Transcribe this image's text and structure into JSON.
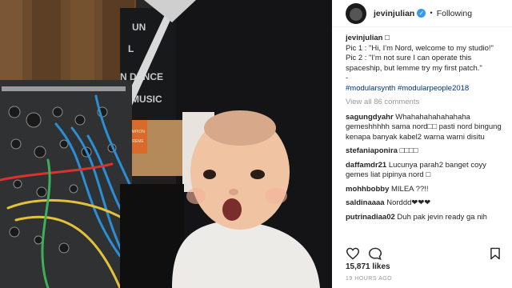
{
  "post": {
    "username": "jevinjulian",
    "follow_label": "Following",
    "separator": "•",
    "verified_icon": "verified-badge-icon"
  },
  "poster": {
    "wall_sign_lines": [
      "UN",
      "L",
      "N DENCE",
      "D MUSIC"
    ],
    "sticker_lines": [
      "CHAMPION",
      "SUPREME"
    ]
  },
  "caption": {
    "username": "jevinjulian",
    "lines": [
      "Pic 1 : \"Hi, I'm Nord, welcome to my studio!\"",
      "Pic 2 : \"I'm not sure I can operate this spaceship, but lemme try my first patch.\"",
      "-"
    ],
    "hashtags": "#modularsynth #modularpeople2018",
    "emoji": "□"
  },
  "view_all": "View all 86 comments",
  "comments": [
    {
      "user": "sagungdyahr",
      "text": "Whahahahahahahaha gemeshhhhh sama nord□□ pasti nord bingung kenapa banyak kabel2 warna warni disitu"
    },
    {
      "user": "stefaniaponira",
      "text": "□□□□"
    },
    {
      "user": "daffamdr21",
      "text": "Lucunya parah2 banget coyy gemes liat pipinya nord □"
    },
    {
      "user": "mohhbobby",
      "text": "MILEA ??!!"
    },
    {
      "user": "saldinaaaa",
      "text": "Norddd❤❤❤"
    },
    {
      "user": "putrinadiaa02",
      "text": "Duh pak jevin ready ga nih"
    }
  ],
  "likes": "15,871 likes",
  "time": "19 HOURS AGO",
  "colors": {
    "accent": "#3897f0",
    "cable_blue": "#2a8fd6",
    "cable_red": "#d8342c",
    "cable_yellow": "#e3c23a",
    "cable_green": "#3fae5a"
  },
  "icons": [
    "heart-icon",
    "comment-icon",
    "bookmark-icon"
  ]
}
